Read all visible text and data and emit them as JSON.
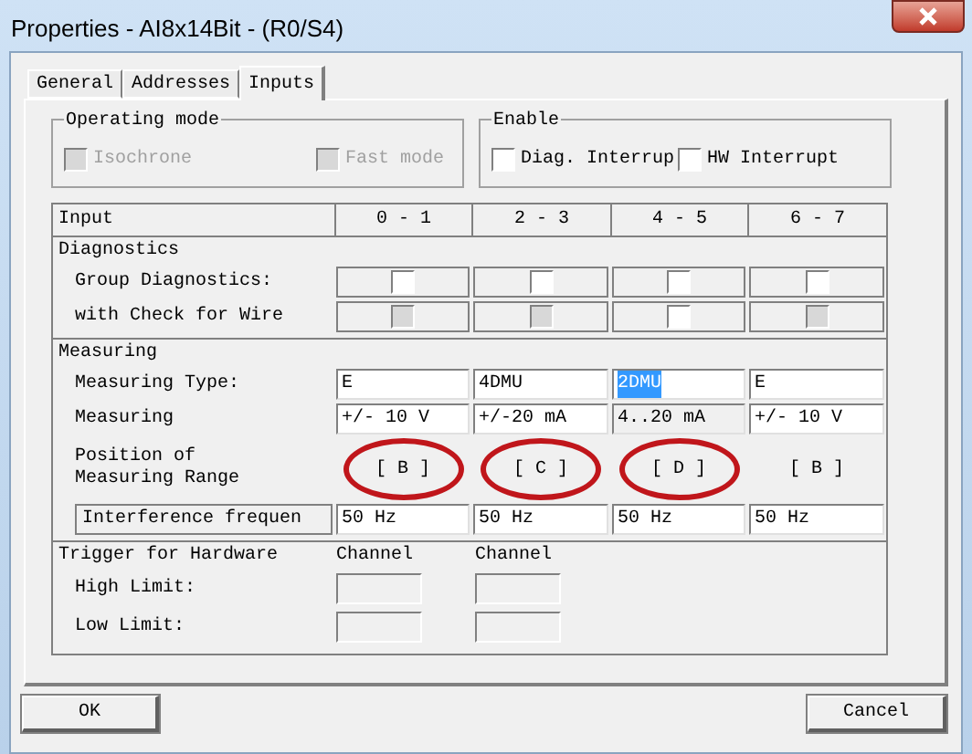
{
  "window": {
    "title": "Properties - AI8x14Bit - (R0/S4)"
  },
  "tabs": [
    {
      "label": "General",
      "selected": false
    },
    {
      "label": "Addresses",
      "selected": false
    },
    {
      "label": "Inputs",
      "selected": true
    }
  ],
  "operating_mode": {
    "title": "Operating mode",
    "options": [
      {
        "label": "Isochrone",
        "checked": false,
        "disabled": true
      },
      {
        "label": "Fast mode",
        "checked": false,
        "disabled": true
      }
    ]
  },
  "enable": {
    "title": "Enable",
    "options": [
      {
        "label": "Diag. Interrup",
        "checked": false,
        "disabled": false
      },
      {
        "label": "HW Interrupt",
        "checked": false,
        "disabled": false
      }
    ]
  },
  "table": {
    "columns": [
      "Input",
      "0 - 1",
      "2 - 3",
      "4 - 5",
      "6 - 7"
    ],
    "sections": [
      {
        "title": "Diagnostics",
        "rows": [
          {
            "label": "Group Diagnostics:",
            "kind": "checkbox",
            "cells": [
              {
                "checked": false,
                "disabled": false
              },
              {
                "checked": false,
                "disabled": false
              },
              {
                "checked": false,
                "disabled": false
              },
              {
                "checked": false,
                "disabled": false
              }
            ]
          },
          {
            "label": "with Check for Wire",
            "kind": "checkbox",
            "cells": [
              {
                "checked": false,
                "disabled": true
              },
              {
                "checked": false,
                "disabled": true
              },
              {
                "checked": false,
                "disabled": false
              },
              {
                "checked": false,
                "disabled": true
              }
            ]
          }
        ]
      },
      {
        "title": "Measuring",
        "rows": [
          {
            "label": "Measuring Type:",
            "kind": "field",
            "cells": [
              {
                "value": "E",
                "selected": false,
                "disabled": false
              },
              {
                "value": "4DMU",
                "selected": false,
                "disabled": false
              },
              {
                "value": "2DMU",
                "selected": true,
                "disabled": false
              },
              {
                "value": "E",
                "selected": false,
                "disabled": false
              }
            ]
          },
          {
            "label": "Measuring",
            "kind": "field",
            "cells": [
              {
                "value": "+/- 10 V",
                "selected": false,
                "disabled": false
              },
              {
                "value": "+/-20 mA",
                "selected": false,
                "disabled": false
              },
              {
                "value": "4..20 mA",
                "selected": false,
                "disabled": true
              },
              {
                "value": "+/- 10 V",
                "selected": false,
                "disabled": false
              }
            ]
          },
          {
            "label": "Position of\nMeasuring Range",
            "kind": "range",
            "cells": [
              {
                "value": "[ B ]",
                "circled": true
              },
              {
                "value": "[ C ]",
                "circled": true
              },
              {
                "value": "[ D ]",
                "circled": true
              },
              {
                "value": "[ B ]",
                "circled": false
              }
            ]
          },
          {
            "label": "Interference frequen",
            "kind": "framed_field",
            "cells": [
              {
                "value": "50 Hz",
                "selected": false,
                "disabled": false
              },
              {
                "value": "50 Hz",
                "selected": false,
                "disabled": false
              },
              {
                "value": "50 Hz",
                "selected": false,
                "disabled": false
              },
              {
                "value": "50 Hz",
                "selected": false,
                "disabled": false
              }
            ]
          }
        ]
      }
    ]
  },
  "trigger": {
    "title": "Trigger for Hardware",
    "columns": [
      "Channel",
      "Channel"
    ],
    "rows": [
      {
        "label": "High Limit:",
        "fields": [
          {
            "disabled": true
          },
          {
            "disabled": true
          }
        ]
      },
      {
        "label": "Low Limit:",
        "fields": [
          {
            "disabled": true
          },
          {
            "disabled": true
          }
        ]
      }
    ]
  },
  "buttons": [
    {
      "label": "OK"
    },
    {
      "label": "Cancel"
    }
  ]
}
